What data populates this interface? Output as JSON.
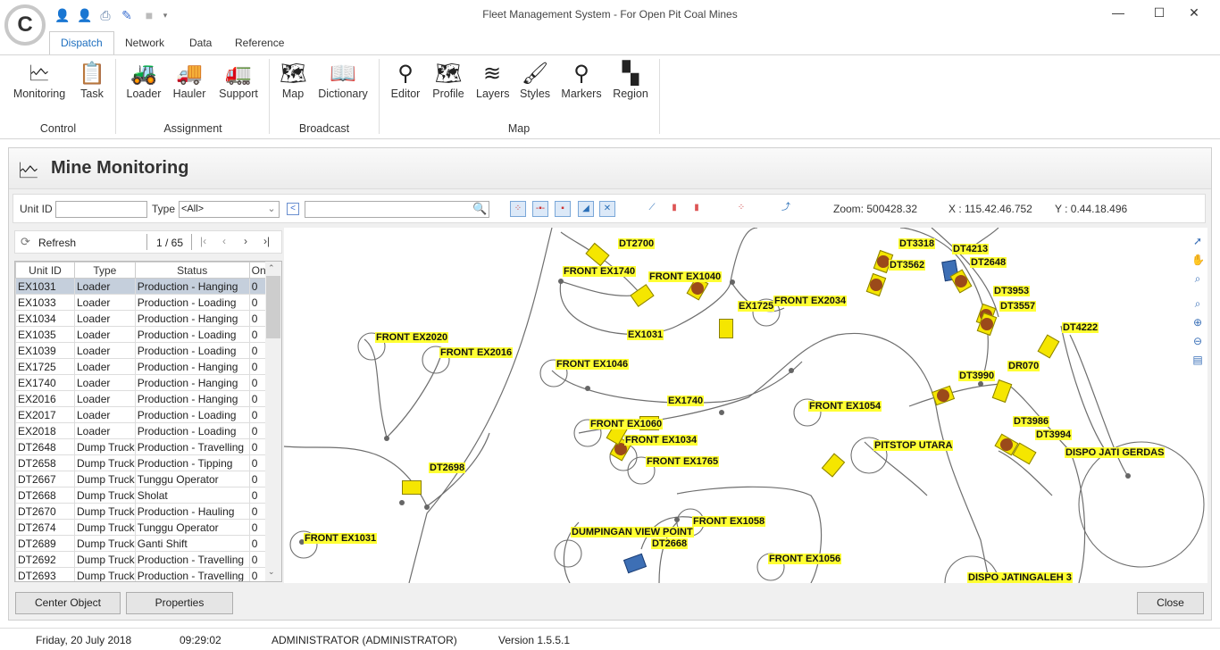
{
  "app": {
    "title": "Fleet Management System - For Open Pit Coal Mines",
    "logo": "C"
  },
  "quick_access": [
    "user-arrow-icon",
    "user-key-icon",
    "printer-icon",
    "edit-ruler-icon",
    "blank-icon"
  ],
  "window": {
    "minimize": "—",
    "maximize": "☐",
    "close": "✕"
  },
  "tabs": [
    {
      "label": "Dispatch",
      "active": true
    },
    {
      "label": "Network"
    },
    {
      "label": "Data"
    },
    {
      "label": "Reference"
    }
  ],
  "ribbon": {
    "buttons": [
      {
        "label": "Monitoring",
        "icon": "monitor-chart-icon"
      },
      {
        "label": "Task",
        "icon": "clipboard-icon"
      },
      {
        "label": "Loader",
        "icon": "excavator-icon"
      },
      {
        "label": "Hauler",
        "icon": "dump-truck-icon"
      },
      {
        "label": "Support",
        "icon": "truck-icon"
      },
      {
        "label": "Map",
        "icon": "map-icon"
      },
      {
        "label": "Dictionary",
        "icon": "book-icon"
      },
      {
        "label": "Editor",
        "icon": "pin-icon"
      },
      {
        "label": "Profile",
        "icon": "map-fold-icon"
      },
      {
        "label": "Layers",
        "icon": "layers-icon"
      },
      {
        "label": "Styles",
        "icon": "brush-icon"
      },
      {
        "label": "Markers",
        "icon": "marker-icon"
      },
      {
        "label": "Region",
        "icon": "region-icon"
      }
    ],
    "groups": [
      "Control",
      "Assignment",
      "Broadcast",
      "Map"
    ]
  },
  "panel": {
    "title": "Mine Monitoring"
  },
  "filter": {
    "unit_id_label": "Unit ID",
    "unit_id_value": "",
    "type_label": "Type",
    "type_value": "<All>",
    "search_value": "",
    "zoom": "Zoom: 500428.32",
    "x": "X : 115.42.46.752",
    "y": "Y : 0.44.18.496"
  },
  "grid": {
    "refresh": "Refresh",
    "page": "1 / 65",
    "columns": [
      "Unit ID",
      "Type",
      "Status",
      "On"
    ],
    "rows": [
      [
        "EX1031",
        "Loader",
        "Production - Hanging",
        "0"
      ],
      [
        "EX1033",
        "Loader",
        "Production - Loading",
        "0"
      ],
      [
        "EX1034",
        "Loader",
        "Production - Hanging",
        "0"
      ],
      [
        "EX1035",
        "Loader",
        "Production - Loading",
        "0"
      ],
      [
        "EX1039",
        "Loader",
        "Production - Loading",
        "0"
      ],
      [
        "EX1725",
        "Loader",
        "Production - Hanging",
        "0"
      ],
      [
        "EX1740",
        "Loader",
        "Production - Hanging",
        "0"
      ],
      [
        "EX2016",
        "Loader",
        "Production - Hanging",
        "0"
      ],
      [
        "EX2017",
        "Loader",
        "Production - Loading",
        "0"
      ],
      [
        "EX2018",
        "Loader",
        "Production - Loading",
        "0"
      ],
      [
        "DT2648",
        "Dump Truck",
        "Production - Travelling",
        "0"
      ],
      [
        "DT2658",
        "Dump Truck",
        "Production - Tipping",
        "0"
      ],
      [
        "DT2667",
        "Dump Truck",
        "Tunggu Operator",
        "0"
      ],
      [
        "DT2668",
        "Dump Truck",
        "Sholat",
        "0"
      ],
      [
        "DT2670",
        "Dump Truck",
        "Production - Hauling",
        "0"
      ],
      [
        "DT2674",
        "Dump Truck",
        "Tunggu Operator",
        "0"
      ],
      [
        "DT2689",
        "Dump Truck",
        "Ganti Shift",
        "0"
      ],
      [
        "DT2692",
        "Dump Truck",
        "Production - Travelling",
        "0"
      ],
      [
        "DT2693",
        "Dump Truck",
        "Production - Travelling",
        "0"
      ]
    ]
  },
  "map": {
    "labels": [
      "DT2700",
      "FRONT EX1740",
      "FRONT EX1040",
      "EX1725",
      "FRONT EX2034",
      "DT3318",
      "DT4213",
      "DT3562",
      "DT2648",
      "DT3953",
      "DT3557",
      "DT4222",
      "EX1031",
      "FRONT EX2020",
      "FRONT EX2016",
      "FRONT EX1046",
      "DT3990",
      "DR070",
      "EX1740",
      "FRONT EX1054",
      "FRONT EX1060",
      "FRONT EX1034",
      "DT3986",
      "DT3994",
      "PITSTOP UTARA",
      "DISPO JATI GERDAS",
      "FRONT EX1765",
      "DT2698",
      "FRONT EX1058",
      "DUMPINGAN VIEW POINT",
      "DT2668",
      "FRONT EX1031",
      "FRONT EX1056",
      "DISPO JATINGALEH 3"
    ],
    "tools": [
      "pointer-icon",
      "pan-hand-icon",
      "zoom-window-icon",
      "zoom-extent-icon",
      "zoom-in-icon",
      "zoom-out-icon",
      "print-preview-icon"
    ]
  },
  "footer": {
    "center_object": "Center Object",
    "properties": "Properties",
    "close": "Close"
  },
  "status": {
    "date": "Friday, 20 July 2018",
    "time": "09:29:02",
    "user": "ADMINISTRATOR (ADMINISTRATOR)",
    "version": "Version 1.5.5.1"
  }
}
